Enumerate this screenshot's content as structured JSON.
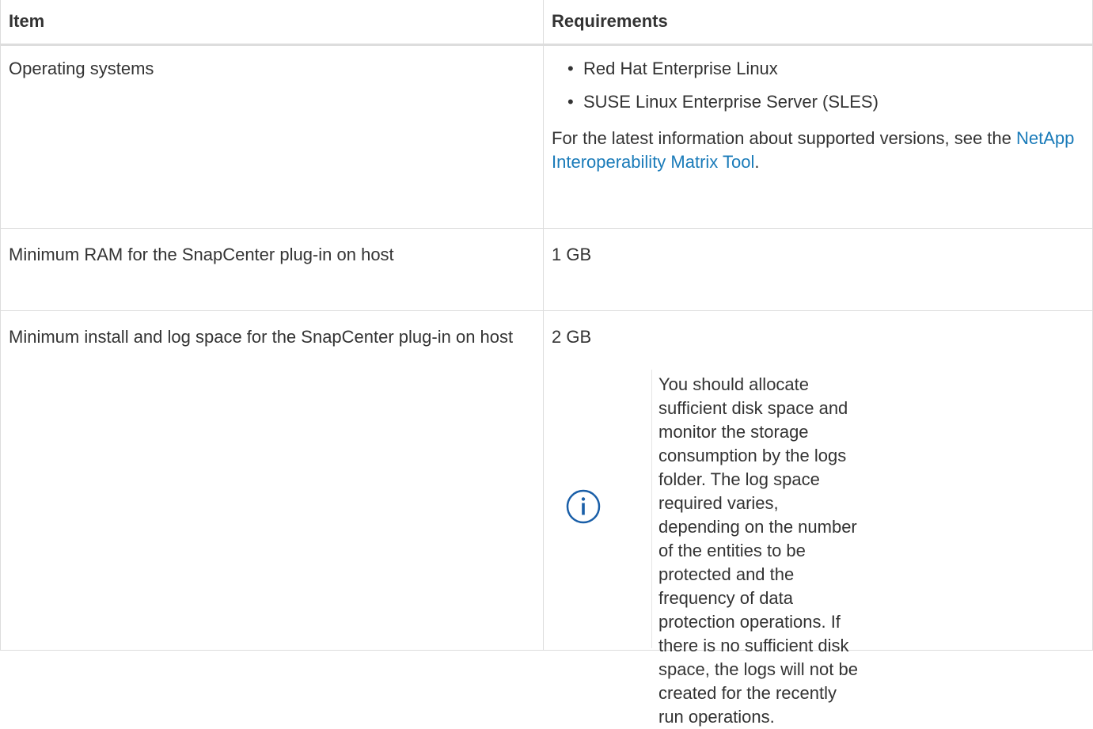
{
  "table": {
    "headers": {
      "item": "Item",
      "requirements": "Requirements"
    },
    "rows": {
      "os": {
        "item": "Operating systems",
        "bullets": [
          "Red Hat Enterprise Linux",
          "SUSE Linux Enterprise Server (SLES)"
        ],
        "note_prefix": "For the latest information about supported versions, see the ",
        "note_link": "NetApp Interoperability Matrix Tool",
        "note_suffix": "."
      },
      "ram": {
        "item": "Minimum RAM for the SnapCenter plug-in on host",
        "value": "1 GB"
      },
      "space": {
        "item": "Minimum install and log space for the SnapCenter plug-in on host",
        "value": "2 GB",
        "note_icon": "info-circle-icon",
        "note_text": "You should allocate sufficient disk space and monitor the storage consumption by the logs folder. The log space required varies, depending on the number of the entities to be protected and the frequency of data protection operations. If there is no sufficient disk space, the logs will not be created for the recently run operations."
      }
    }
  },
  "colors": {
    "text": "#333333",
    "link": "#1a7bb9",
    "border": "#dddddd",
    "icon": "#1a5fa8"
  }
}
